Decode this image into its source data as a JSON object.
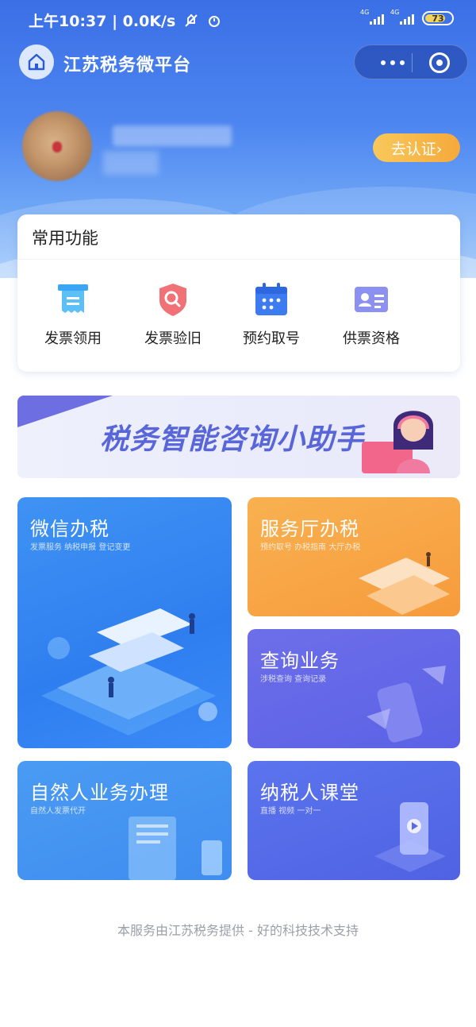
{
  "status_bar": {
    "time": "上午10:37",
    "net_speed": "0.0K/s",
    "signal_label": "4G",
    "battery": "73"
  },
  "nav": {
    "title": "江苏税务微平台"
  },
  "profile": {
    "certify_button": "去认证›"
  },
  "common_functions": {
    "title": "常用功能",
    "items": [
      {
        "label": "发票领用",
        "icon": "invoice-receive-icon",
        "color": "#3aa6f4"
      },
      {
        "label": "发票验旧",
        "icon": "invoice-check-icon",
        "color": "#f06a70"
      },
      {
        "label": "预约取号",
        "icon": "calendar-icon",
        "color": "#3d7bf0"
      },
      {
        "label": "供票资格",
        "icon": "id-card-icon",
        "color": "#8a8ef0"
      }
    ]
  },
  "banner": {
    "text": "税务智能咨询小助手"
  },
  "tiles": {
    "wechat": {
      "title": "微信办税",
      "subtitle": "发票服务 纳税申报 登记变更"
    },
    "hall": {
      "title": "服务厅办税",
      "subtitle": "预约取号 办税指南 大厅办税"
    },
    "query": {
      "title": "查询业务",
      "subtitle": "涉税查询 查询记录"
    },
    "person": {
      "title": "自然人业务办理",
      "subtitle": "自然人发票代开"
    },
    "class": {
      "title": "纳税人课堂",
      "subtitle": "直播 视频 一对一"
    }
  },
  "footer": {
    "text": "本服务由江苏税务提供 - 好的科技技术支持"
  },
  "colors": {
    "header": "#4d86f0",
    "accent_orange": "#f6a93b"
  }
}
